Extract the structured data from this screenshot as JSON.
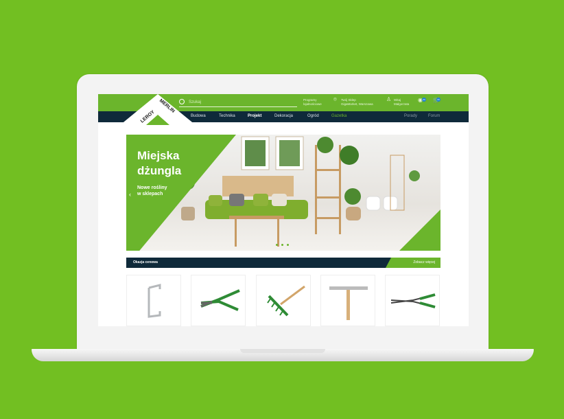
{
  "header": {
    "search_placeholder": "Szukaj",
    "programs": [
      "Programy",
      "lojalnościowe"
    ],
    "store": [
      "Twój Sklep",
      "GigaMarket, Warszawa"
    ],
    "user": [
      "Witaj",
      "Małgorzata"
    ],
    "badges": [
      "00",
      "00"
    ],
    "logo": "LEROY MERLIN"
  },
  "nav": {
    "items": [
      "Budowa",
      "Technika",
      "Projekt",
      "Dekoracja",
      "Ogród",
      "Gazetka"
    ],
    "right": [
      "Porady",
      "Forum"
    ]
  },
  "hero": {
    "title_line1": "Miejska",
    "title_line2": "dżungla",
    "subtitle_line1": "Nowe rośliny",
    "subtitle_line2": "w sklepach"
  },
  "deals": {
    "label": "Okazja cenowa",
    "more": "Zobacz więcej"
  },
  "products": [
    "Hak",
    "Sekator",
    "Grabie",
    "Łata tynkarska",
    "Nożyce do żywopłotu"
  ],
  "colors": {
    "brand": "#6bb52c",
    "navy": "#0f2a3a"
  }
}
